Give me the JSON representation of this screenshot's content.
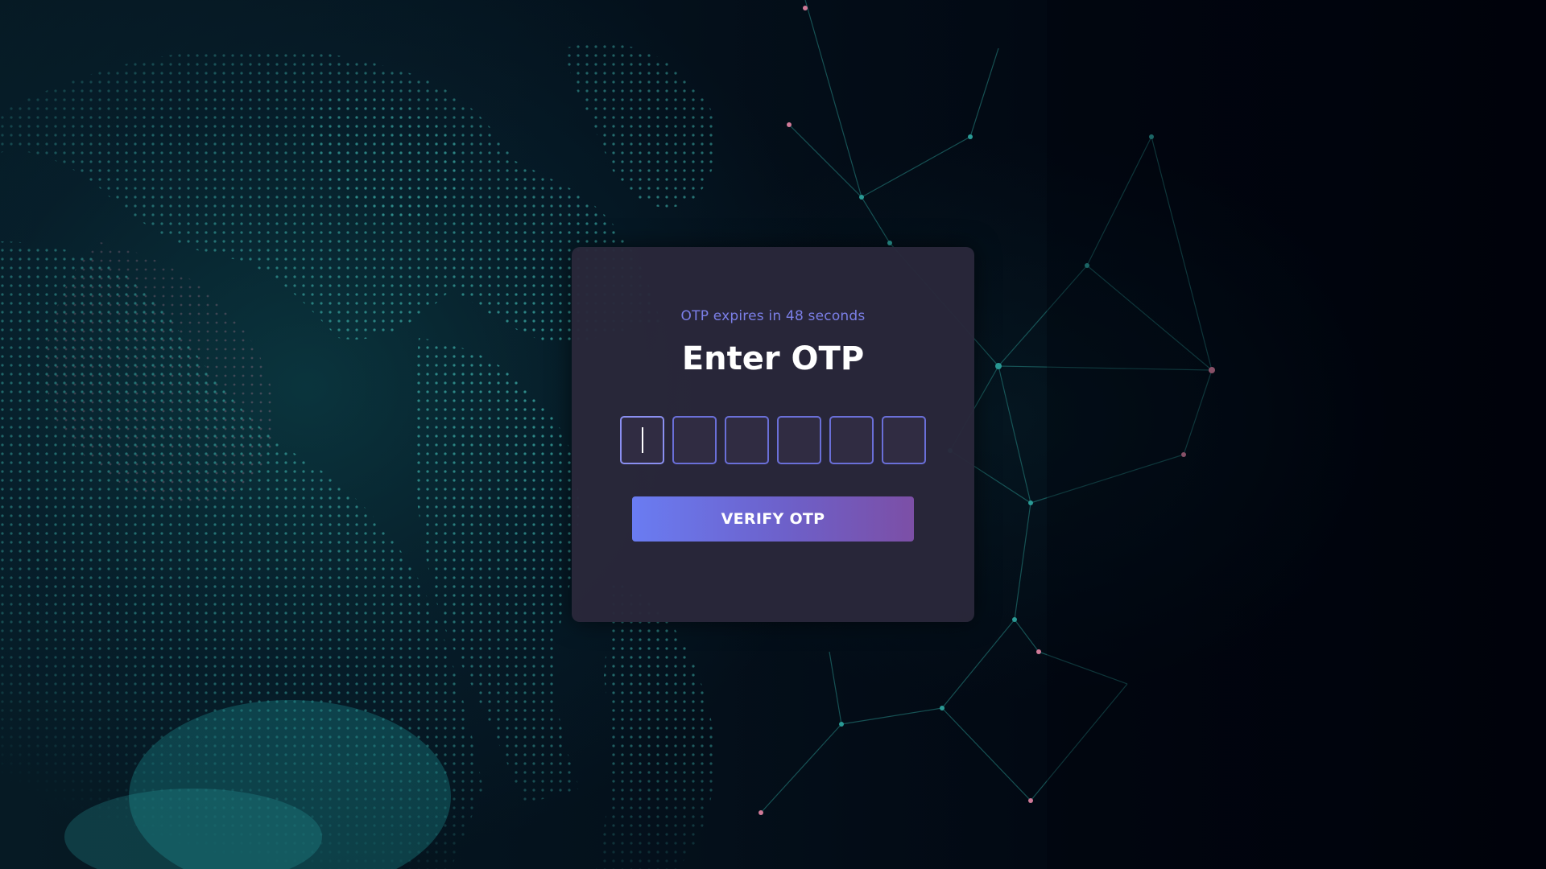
{
  "otp_card": {
    "timer_text": "OTP expires in 48 seconds",
    "title": "Enter OTP",
    "digits": [
      "",
      "",
      "",
      "",
      "",
      ""
    ],
    "verify_label": "VERIFY OTP"
  },
  "colors": {
    "accent": "#7b7fe8",
    "card_background": "#2a283a",
    "button_gradient_start": "#6a7cf2",
    "button_gradient_end": "#7c4fa6"
  },
  "background": {
    "description_icon": "globe-network-icon"
  }
}
